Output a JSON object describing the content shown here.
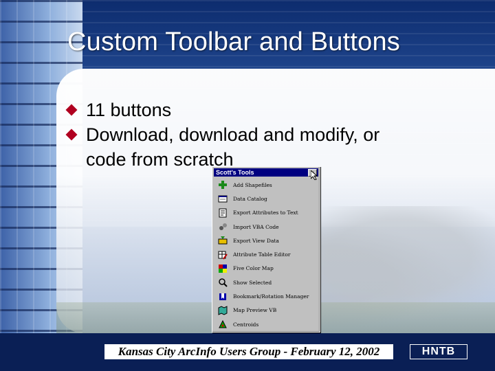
{
  "slide": {
    "title": "Custom Toolbar and Buttons",
    "bullets": [
      {
        "text": "11 buttons"
      },
      {
        "text": "Download, download and modify, or",
        "continuation": "code from scratch"
      }
    ]
  },
  "toolbar_window": {
    "title": "Scott's Tools",
    "close_label": "x",
    "items": [
      {
        "label": "Add Shapefiles",
        "icon": "add-shapefile-icon"
      },
      {
        "label": "Data Catalog",
        "icon": "catalog-icon"
      },
      {
        "label": "Export Attributes to Text",
        "icon": "export-text-icon"
      },
      {
        "label": "Import VBA Code",
        "icon": "vba-icon"
      },
      {
        "label": "Export View Data",
        "icon": "export-view-icon"
      },
      {
        "label": "Attribute Table Editor",
        "icon": "table-editor-icon"
      },
      {
        "label": "Five Color Map",
        "icon": "color-map-icon"
      },
      {
        "label": "Show Selected",
        "icon": "show-selected-icon"
      },
      {
        "label": "Bookmark/Rotation Manager",
        "icon": "bookmark-icon"
      },
      {
        "label": "Map Preview VB",
        "icon": "map-preview-icon"
      },
      {
        "label": "Centroids",
        "icon": "centroid-icon"
      }
    ]
  },
  "footer": {
    "caption": "Kansas City ArcInfo Users Group - February 12, 2002",
    "logo": "HNTB"
  },
  "colors": {
    "bullet": "#b00020",
    "titlebar": "#000080",
    "footer_bg": "#0a1f55"
  }
}
